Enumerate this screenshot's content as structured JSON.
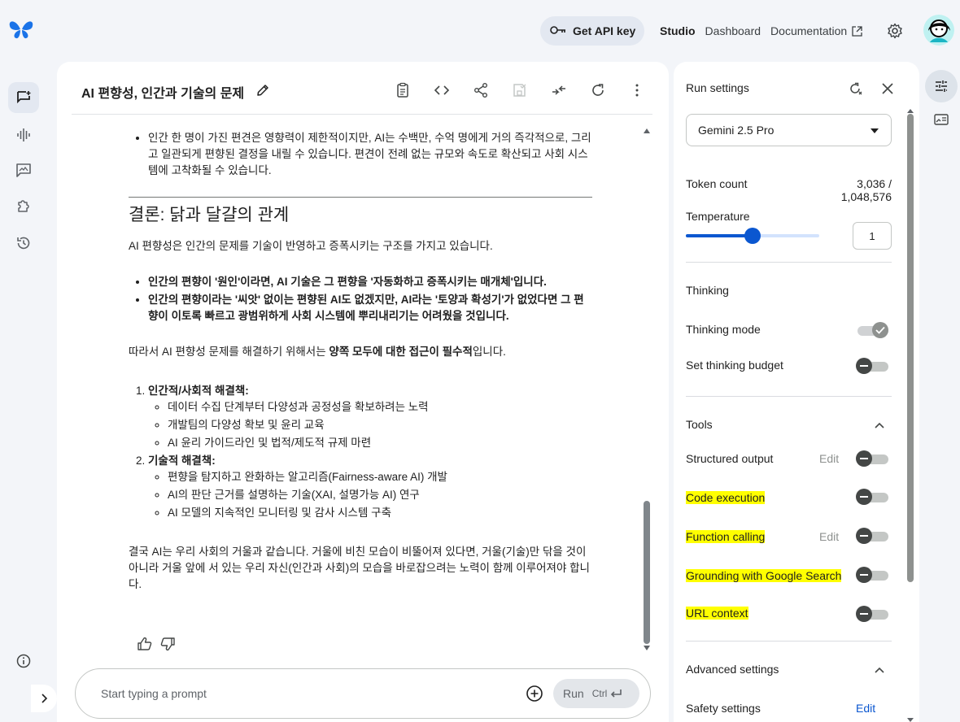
{
  "header": {
    "api_button": "Get API key",
    "studio": "Studio",
    "dashboard": "Dashboard",
    "documentation": "Documentation"
  },
  "chat": {
    "title": "AI 편향성, 인간과 기술의 문제",
    "intro_bullet": "인간 한 명이 가진 편견은 영향력이 제한적이지만, AI는 수백만, 수억 명에게 거의 즉각적으로, 그리고 일관되게 편향된 결정을 내릴 수 있습니다. 편견이 전례 없는 규모와 속도로 확산되고 사회 시스템에 고착화될 수 있습니다.",
    "heading": "결론: 닭과 달걀의 관계",
    "para1": "AI 편향성은 인간의 문제를 기술이 반영하고 증폭시키는 구조를 가지고 있습니다.",
    "bold_bullets": [
      "인간의 편향이 '원인'이라면, AI 기술은 그 편향을 '자동화하고 증폭시키는 매개체'입니다.",
      "인간의 편향이라는 '씨앗' 없이는 편향된 AI도 없겠지만, AI라는 '토양과 확성기'가 없었다면 그 편향이 이토록 빠르고 광범위하게 사회 시스템에 뿌리내리기는 어려웠을 것입니다."
    ],
    "para2_pre": "따라서 AI 편향성 문제를 해결하기 위해서는 ",
    "para2_bold": "양쪽 모두에 대한 접근이 필수적",
    "para2_post": "입니다.",
    "solutions": [
      {
        "title": "인간적/사회적 해결책:",
        "items": [
          "데이터 수집 단계부터 다양성과 공정성을 확보하려는 노력",
          "개발팀의 다양성 확보 및 윤리 교육",
          "AI 윤리 가이드라인 및 법적/제도적 규제 마련"
        ]
      },
      {
        "title": "기술적 해결책:",
        "items": [
          "편향을 탐지하고 완화하는 알고리즘(Fairness-aware AI) 개발",
          "AI의 판단 근거를 설명하는 기술(XAI, 설명가능 AI) 연구",
          "AI 모델의 지속적인 모니터링 및 감사 시스템 구축"
        ]
      }
    ],
    "closing": "결국 AI는 우리 사회의 거울과 같습니다. 거울에 비친 모습이 비뚤어져 있다면, 거울(기술)만 닦을 것이 아니라 거울 앞에 서 있는 우리 자신(인간과 사회)의 모습을 바로잡으려는 노력이 함께 이루어져야 합니다."
  },
  "prompt": {
    "placeholder": "Start typing a prompt",
    "run_label": "Run",
    "shortcut": "Ctrl"
  },
  "settings": {
    "title": "Run settings",
    "model": "Gemini 2.5 Pro",
    "token_label": "Token count",
    "token_value": "3,036 / 1,048,576",
    "temperature_label": "Temperature",
    "temperature_value": "1",
    "temperature_fraction": 0.5,
    "thinking_section": "Thinking",
    "thinking_mode": "Thinking mode",
    "thinking_budget": "Set thinking budget",
    "tools_section": "Tools",
    "structured_output": "Structured output",
    "code_execution": "Code execution",
    "function_calling": "Function calling",
    "grounding": "Grounding with Google Search",
    "url_context": "URL context",
    "edit": "Edit",
    "advanced_section": "Advanced settings",
    "safety_settings": "Safety settings"
  },
  "colors": {
    "accent": "#0b57d0",
    "highlight": "#ffff00"
  }
}
